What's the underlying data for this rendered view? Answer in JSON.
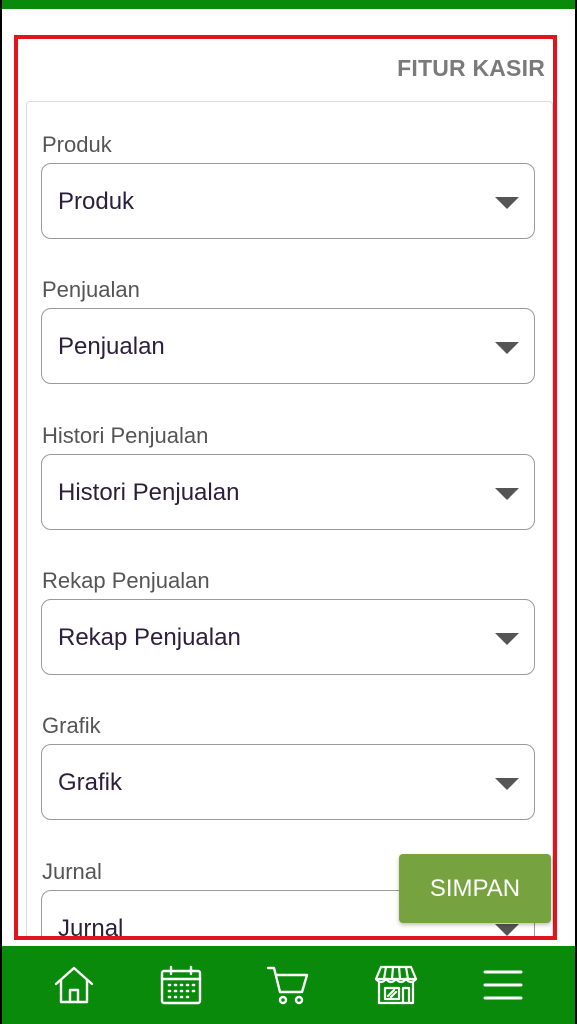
{
  "header": {
    "section_title": "FITUR KASIR"
  },
  "fields": [
    {
      "label": "Produk",
      "value": "Produk"
    },
    {
      "label": "Penjualan",
      "value": "Penjualan"
    },
    {
      "label": "Histori Penjualan",
      "value": "Histori Penjualan"
    },
    {
      "label": "Rekap Penjualan",
      "value": "Rekap Penjualan"
    },
    {
      "label": "Grafik",
      "value": "Grafik"
    },
    {
      "label": "Jurnal",
      "value": "Jurnal"
    }
  ],
  "actions": {
    "save_label": "SIMPAN"
  },
  "bottom_nav": [
    {
      "icon": "home-icon"
    },
    {
      "icon": "calendar-icon"
    },
    {
      "icon": "cart-icon"
    },
    {
      "icon": "store-icon"
    },
    {
      "icon": "menu-icon"
    }
  ],
  "colors": {
    "brand_green": "#0a8a0a",
    "save_button": "#76a340",
    "highlight_border": "#e0141e"
  }
}
